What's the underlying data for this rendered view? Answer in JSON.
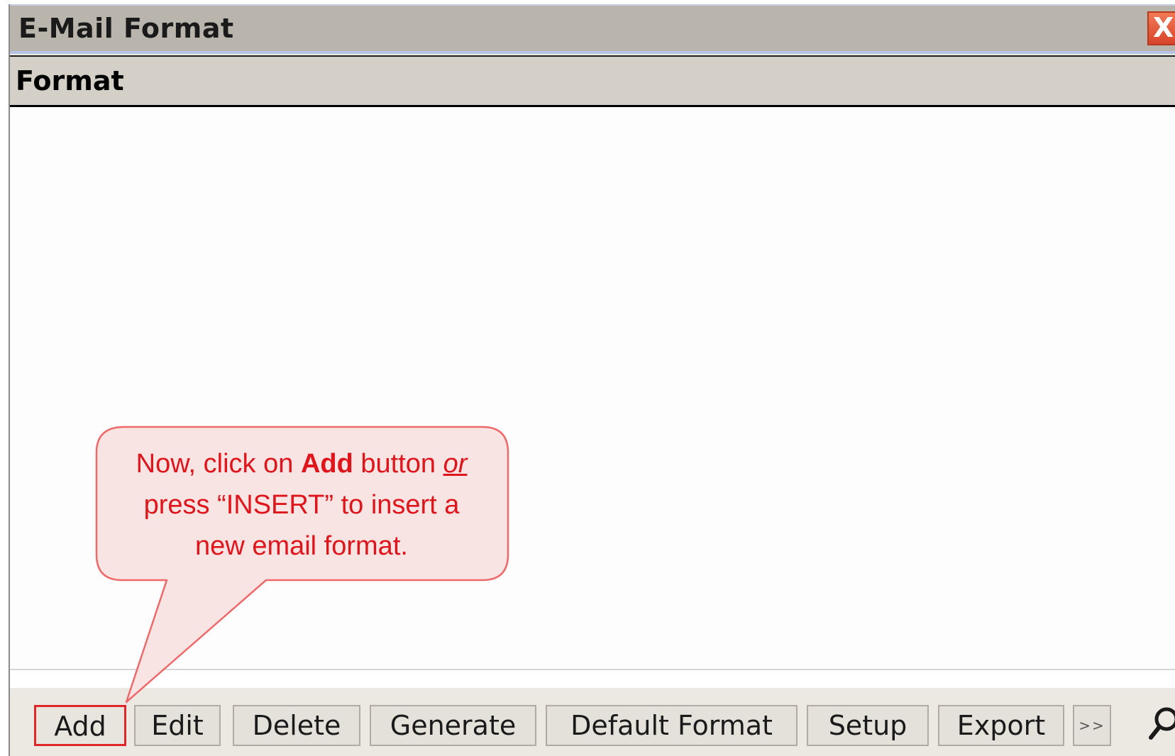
{
  "window": {
    "title": "E-Mail Format",
    "close_label": "X"
  },
  "grid": {
    "column_header": "Format",
    "rows": [
      "",
      "",
      "",
      "",
      "",
      "",
      "",
      "",
      "",
      "",
      "",
      ""
    ]
  },
  "toolbar": {
    "buttons": [
      {
        "label": "Add"
      },
      {
        "label": "Edit"
      },
      {
        "label": "Delete"
      },
      {
        "label": "Generate"
      },
      {
        "label": "Default Format"
      },
      {
        "label": "Setup"
      },
      {
        "label": "Export"
      },
      {
        "label": ">>"
      }
    ],
    "search_icon": "search-icon"
  },
  "callout": {
    "line1_pre": "Now, click on ",
    "line1_bold": "Add",
    "line1_mid": " button ",
    "line1_italic": "or",
    "line2": "press “INSERT” to insert a",
    "line3": "new email format.",
    "text_color": "#e0151b",
    "fill_color": "#f9e4e4",
    "border_color": "#ee6a6a"
  }
}
